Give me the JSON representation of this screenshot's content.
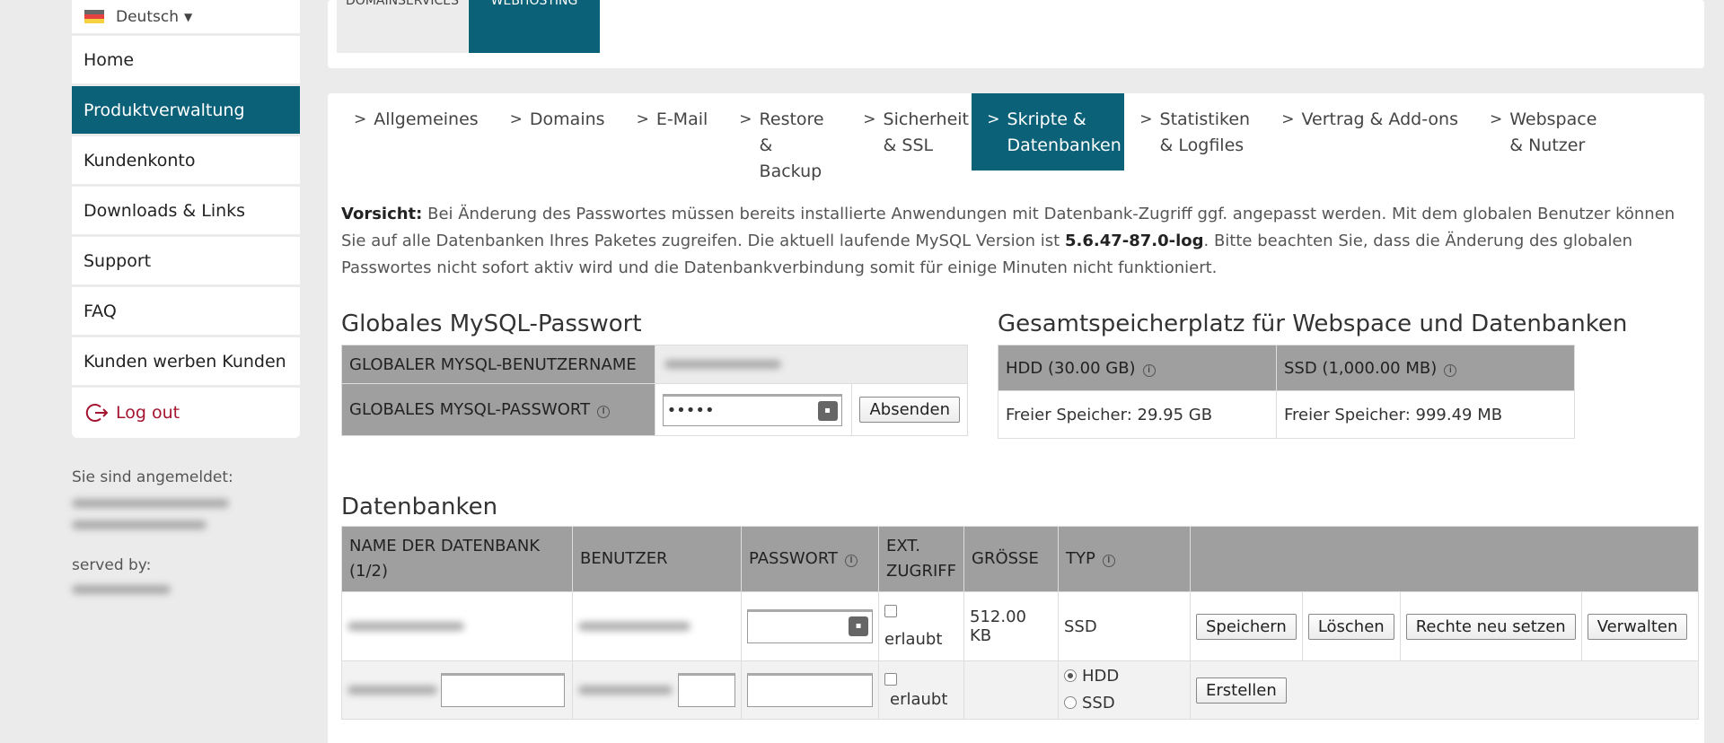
{
  "sidebar": {
    "language": "Deutsch",
    "items": [
      {
        "label": "Home"
      },
      {
        "label": "Produktverwaltung"
      },
      {
        "label": "Kundenkonto"
      },
      {
        "label": "Downloads & Links"
      },
      {
        "label": "Support"
      },
      {
        "label": "FAQ"
      },
      {
        "label": "Kunden werben Kunden"
      }
    ],
    "logout_label": "Log out",
    "logged_in_label": "Sie sind angemeldet:",
    "served_by_label": "served by:"
  },
  "top_tabs": [
    {
      "label": "DOMAINSERVICES"
    },
    {
      "label": "WEBHOSTING"
    }
  ],
  "subtabs": [
    {
      "label": "Allgemeines"
    },
    {
      "label": "Domains"
    },
    {
      "label": "E-Mail"
    },
    {
      "label": "Restore & Backup"
    },
    {
      "label": "Sicherheit & SSL"
    },
    {
      "label": "Skripte & Datenbanken"
    },
    {
      "label": "Statistiken & Logfiles"
    },
    {
      "label": "Vertrag & Add-ons"
    },
    {
      "label": "Webspace & Nutzer"
    }
  ],
  "warning": {
    "prefix": "Vorsicht:",
    "text1": " Bei Änderung des Passwortes müssen bereits installierte Anwendungen mit Datenbank-Zugriff ggf. angepasst werden. Mit dem globalen Benutzer können Sie auf alle Datenbanken Ihres Paketes zugreifen. Die aktuell laufende MySQL Version ist ",
    "version": "5.6.47-87.0-log",
    "text2": ". Bitte beachten Sie, dass die Änderung des globalen Passwortes nicht sofort aktiv wird und die Datenbankverbindung somit für einige Minuten nicht funktioniert."
  },
  "global_pw": {
    "title": "Globales MySQL-Passwort",
    "username_label": "GLOBALER MYSQL-BENUTZERNAME",
    "password_label": "GLOBALES MYSQL-PASSWORT",
    "password_value": "•••••",
    "submit_label": "Absenden"
  },
  "storage": {
    "title": "Gesamtspeicherplatz für Webspace und Datenbanken",
    "hdd_label": "HDD (30.00 GB)",
    "ssd_label": "SSD (1,000.00 MB)",
    "hdd_free": "Freier Speicher: 29.95 GB",
    "ssd_free": "Freier Speicher: 999.49 MB"
  },
  "databases": {
    "title": "Datenbanken",
    "columns": {
      "name": "NAME DER DATENBANK (1/2)",
      "user": "BENUTZER",
      "password": "PASSWORT",
      "ext": "EXT. ZUGRIFF",
      "size": "GRÖSSE",
      "type": "TYP"
    },
    "row": {
      "ext_label": "erlaubt",
      "size": "512.00 KB",
      "type": "SSD",
      "actions": [
        "Speichern",
        "Löschen",
        "Rechte neu setzen",
        "Verwalten"
      ]
    },
    "new_row": {
      "ext_label": "erlaubt",
      "type_options": [
        "HDD",
        "SSD"
      ],
      "create_label": "Erstellen"
    }
  }
}
